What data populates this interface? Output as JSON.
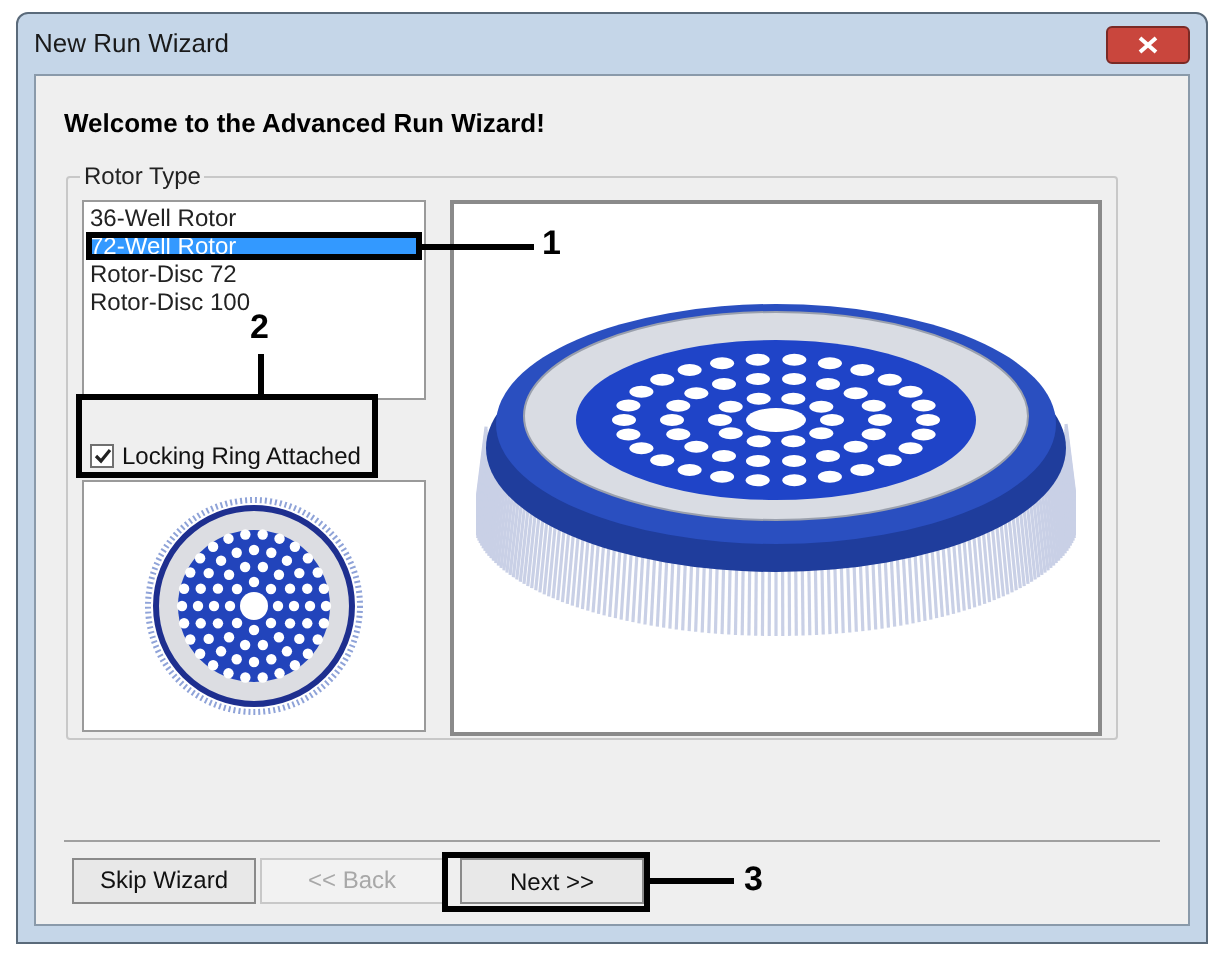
{
  "window": {
    "title": "New Run Wizard"
  },
  "heading": "Welcome to the Advanced Run Wizard!",
  "rotor_type": {
    "label": "Rotor Type",
    "items": [
      {
        "label": "36-Well Rotor",
        "selected": false
      },
      {
        "label": "72-Well Rotor",
        "selected": true
      },
      {
        "label": "Rotor-Disc 72",
        "selected": false
      },
      {
        "label": "Rotor-Disc 100",
        "selected": false
      }
    ]
  },
  "locking_ring": {
    "label": "Locking Ring Attached",
    "checked": true
  },
  "buttons": [
    {
      "label": "Skip Wizard",
      "disabled": false
    },
    {
      "label": "<< Back",
      "disabled": true
    },
    {
      "label": "Next >>",
      "disabled": false
    }
  ],
  "callouts": [
    {
      "number": "1"
    },
    {
      "number": "2"
    },
    {
      "number": "3"
    }
  ]
}
